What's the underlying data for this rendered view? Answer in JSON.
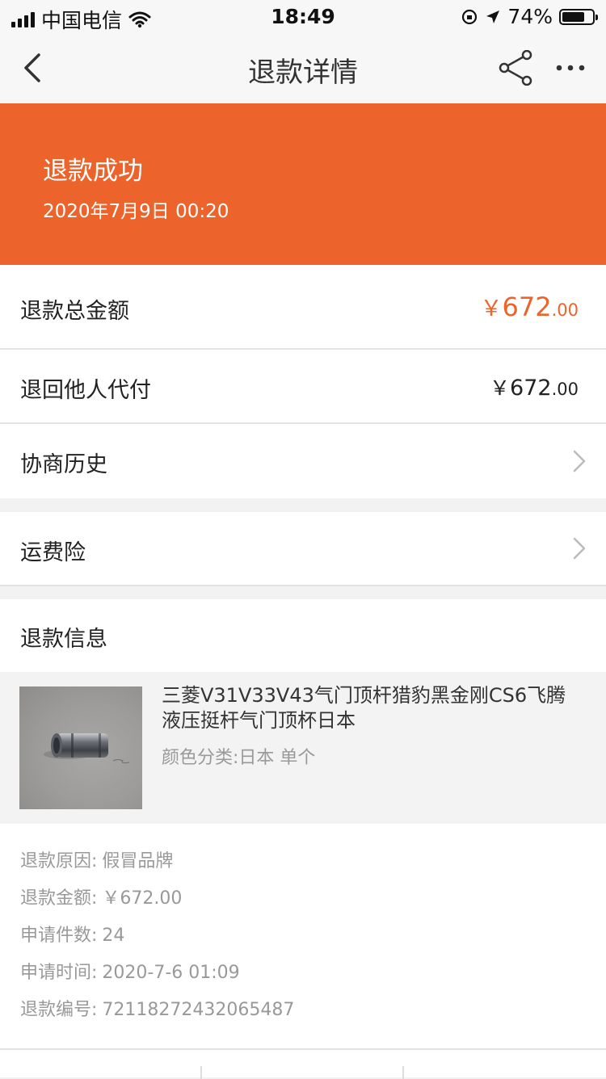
{
  "status_bar": {
    "carrier": "中国电信",
    "time": "18:49",
    "battery_percent": "74%",
    "battery_level": 0.74
  },
  "nav": {
    "title": "退款详情",
    "back_icon": "chevron-left-icon",
    "share_icon": "share-icon",
    "more_icon": "more-horizontal-icon"
  },
  "hero": {
    "status": "退款成功",
    "time": "2020年7月9日 00:20",
    "background_color": "#ec642b"
  },
  "rows": {
    "total": {
      "label": "退款总金额",
      "currency": "￥",
      "integer": "672",
      "decimal": ".00",
      "color": "#ec642b"
    },
    "returned": {
      "label": "退回他人代付",
      "currency": "￥",
      "integer": "672",
      "decimal": ".00"
    },
    "history": {
      "label": "协商历史"
    },
    "insurance": {
      "label": "运费险"
    }
  },
  "refund_info": {
    "heading": "退款信息",
    "product": {
      "title": "三菱V31V33V43气门顶杆猎豹黑金刚CS6飞腾液压挺杆气门顶杯日本",
      "spec": "颜色分类:日本 单个"
    },
    "fields": [
      {
        "label": "退款原因:",
        "value": "假冒品牌"
      },
      {
        "label": "退款金额:",
        "value": "￥672.00"
      },
      {
        "label": "申请件数:",
        "value": "24"
      },
      {
        "label": "申请时间:",
        "value": "2020-7-6 01:09"
      },
      {
        "label": "退款编号:",
        "value": "72118272432065487"
      }
    ]
  }
}
